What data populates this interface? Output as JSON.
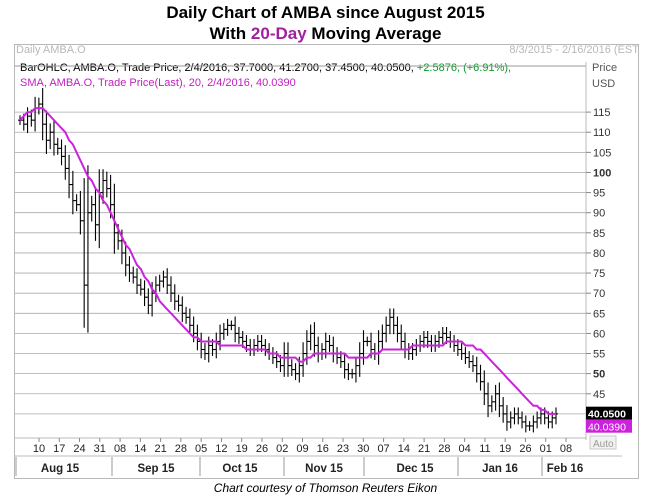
{
  "title_line1": "Daily Chart of AMBA since August 2015",
  "title_line2_pre": "With ",
  "title_line2_highlight": "20-Day",
  "title_line2_post": " Moving Average",
  "panel_title": "Daily AMBA.O",
  "panel_range": "8/3/2015 - 2/16/2016 (EST",
  "legend_ohlc": "BarOHLC, AMBA.O, Trade Price, 2/4/2016, 37.7000, 41.2700, 37.4500, 40.0500,",
  "legend_change": "+2.5876, (+6.91%),",
  "legend_sma": "SMA, AMBA.O, Trade Price(Last), 20, 2/4/2016, 40.0390",
  "price_label": "Price",
  "currency_label": "USD",
  "auto_label": "Auto",
  "credit": "Chart courtesy of Thomson Reuters Eikon",
  "colors": {
    "bars": "#000000",
    "sma": "#cc22dd",
    "price_box": "#000000",
    "sma_box": "#cc22dd",
    "title_highlight": "#a020a0",
    "change": "#0a9a2a"
  },
  "chart_data": {
    "type": "ohlc",
    "ylim": [
      35,
      120
    ],
    "y_ticks": [
      40,
      45,
      50,
      55,
      60,
      65,
      70,
      75,
      80,
      85,
      90,
      95,
      100,
      105,
      110,
      115
    ],
    "y_bold_ticks": [
      50,
      100
    ],
    "day_ticks": [
      "10",
      "17",
      "24",
      "31",
      "08",
      "14",
      "21",
      "28",
      "05",
      "12",
      "19",
      "26",
      "02",
      "09",
      "16",
      "23",
      "30",
      "07",
      "14",
      "21",
      "28",
      "04",
      "11",
      "19",
      "26",
      "01",
      "08"
    ],
    "month_labels": [
      "Aug 15",
      "Sep 15",
      "Oct 15",
      "Nov 15",
      "Dec 15",
      "Jan 16",
      "Feb 16"
    ],
    "last_price": "40.0500",
    "last_sma": "40.0390",
    "close": [
      113,
      112,
      114,
      113,
      116,
      117,
      112,
      108,
      110,
      107,
      106,
      104,
      101,
      97,
      93,
      92,
      88,
      72,
      90,
      92,
      87,
      95,
      98,
      96,
      92,
      85,
      83,
      80,
      77,
      75,
      74,
      72,
      71,
      69,
      67,
      70,
      72,
      73,
      74,
      72,
      70,
      68,
      67,
      65,
      64,
      62,
      60,
      58,
      56,
      55,
      57,
      56,
      58,
      60,
      61,
      62,
      62,
      60,
      59,
      58,
      57,
      56,
      57,
      58,
      57,
      56,
      55,
      54,
      53,
      52,
      55,
      52,
      51,
      50,
      52,
      55,
      58,
      60,
      57,
      55,
      56,
      58,
      57,
      55,
      54,
      53,
      51,
      50,
      50,
      52,
      55,
      58,
      58,
      56,
      55,
      58,
      60,
      62,
      64,
      62,
      60,
      58,
      56,
      55,
      56,
      57,
      58,
      59,
      58,
      57,
      58,
      59,
      60,
      59,
      58,
      57,
      56,
      55,
      54,
      53,
      52,
      50,
      48,
      45,
      42,
      43,
      45,
      42,
      40,
      38,
      39,
      40,
      39,
      38,
      37,
      37,
      38,
      39,
      40,
      39,
      38,
      39,
      40
    ],
    "sma": [
      113,
      114,
      115,
      115,
      116,
      116,
      116,
      115,
      114,
      113,
      112,
      111,
      110,
      108,
      107,
      105,
      103,
      101,
      99,
      98,
      96,
      95,
      93,
      92,
      90,
      88,
      86,
      84,
      82,
      81,
      79,
      77,
      76,
      74,
      73,
      71,
      70,
      68,
      67,
      66,
      65,
      64,
      63,
      62,
      61,
      60,
      59,
      59,
      58,
      58,
      58,
      58,
      58,
      57,
      57,
      57,
      57,
      57,
      57,
      57,
      56,
      56,
      56,
      56,
      56,
      56,
      55,
      55,
      55,
      54,
      54,
      54,
      54,
      54,
      53,
      53,
      54,
      54,
      55,
      55,
      55,
      55,
      55,
      55,
      55,
      55,
      55,
      54,
      54,
      54,
      54,
      54,
      54,
      55,
      55,
      55,
      56,
      56,
      56,
      56,
      56,
      56,
      56,
      56,
      57,
      57,
      57,
      57,
      57,
      57,
      57,
      57,
      57,
      58,
      58,
      58,
      58,
      58,
      57,
      57,
      57,
      56,
      56,
      55,
      54,
      53,
      52,
      51,
      50,
      49,
      48,
      47,
      46,
      45,
      44,
      43,
      42,
      42,
      41,
      41,
      40,
      40,
      40
    ]
  }
}
